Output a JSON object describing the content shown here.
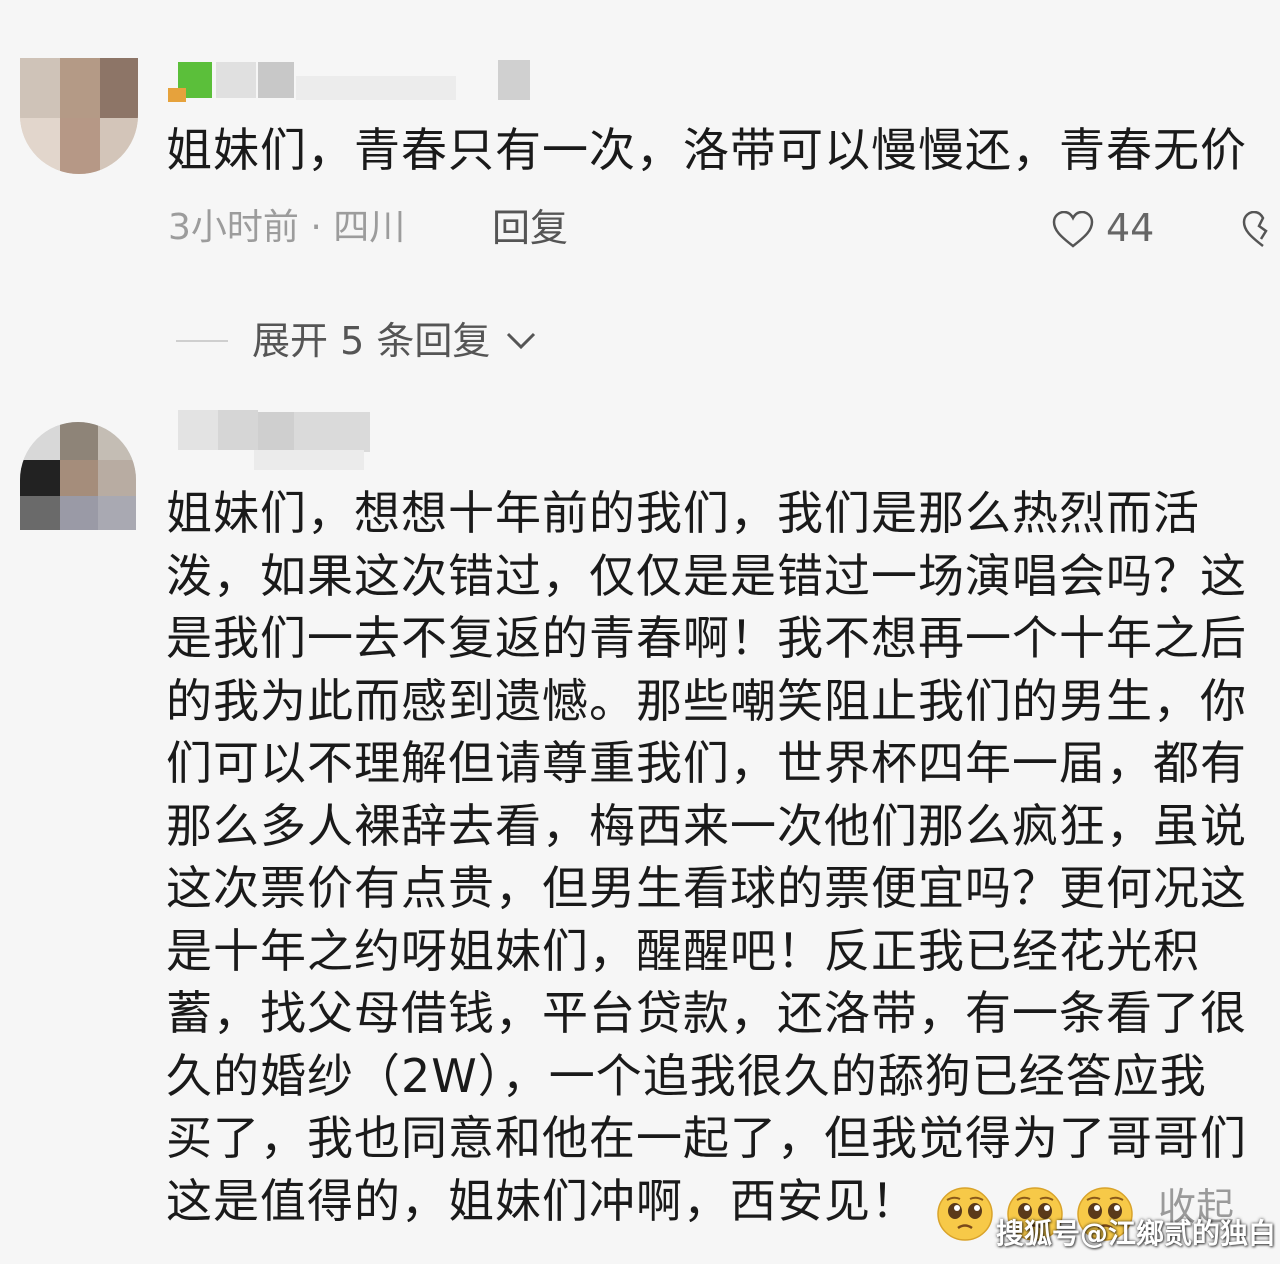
{
  "comment1": {
    "text": "姐妹们，青春只有一次，洛带可以慢慢还，青春无价",
    "meta": "3小时前 · 四川",
    "reply_label": "回复",
    "like_icon": "heart-outline-icon",
    "likes": "44"
  },
  "expand_replies_label": "展开 5 条回复",
  "comment2": {
    "lines": [
      "姐妹们，想想十年前的我们，我们是那么热烈而活",
      "泼，如果这次错过，仅仅是是错过一场演唱会吗？这",
      "是我们一去不复返的青春啊！我不想再一个十年之后",
      "的我为此而感到遗憾。那些嘲笑阻止我们的男生，你",
      "们可以不理解但请尊重我们，世界杯四年一届，都有",
      "那么多人裸辞去看，梅西来一次他们那么疯狂，虽说",
      "这次票价有点贵，但男生看球的票便宜吗？更何况这",
      "是十年之约呀姐妹们，醒醒吧！反正我已经花光积",
      "蓄，找父母借钱，平台贷款，还洛带，有一条看了很",
      "久的婚纱（2W），一个追我很久的舔狗已经答应我",
      "买了，我也同意和他在一起了，但我觉得为了哥哥们",
      "这是值得的，姐妹们冲啊，西安见！"
    ],
    "emojis": [
      "pleading-face-emoji",
      "pleading-face-emoji",
      "pleading-face-emoji"
    ],
    "collapse_label": "收起"
  },
  "watermark": "搜狐号@江鄉贰的独白"
}
